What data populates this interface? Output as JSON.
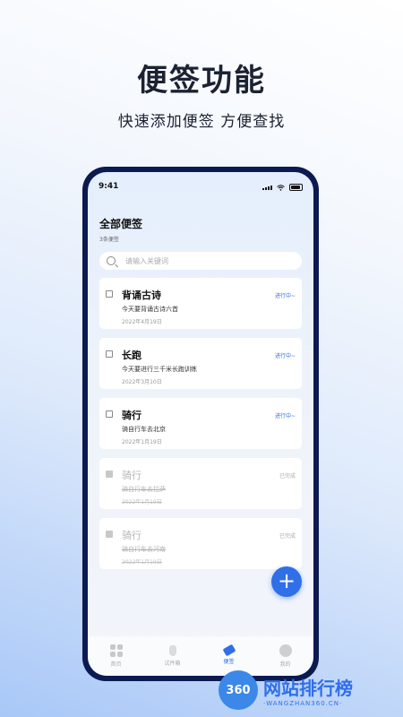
{
  "hero": {
    "title": "便签功能",
    "subtitle": "快速添加便签 方便查找"
  },
  "status_bar": {
    "time": "9:41"
  },
  "page": {
    "title": "全部便签",
    "count": "3条便签"
  },
  "search": {
    "placeholder": "请输入关键词",
    "value": ""
  },
  "notes": [
    {
      "title": "背诵古诗",
      "desc": "今天要背诵古诗六首",
      "date": "2022年4月19日",
      "status": "进行中~",
      "done": false
    },
    {
      "title": "长跑",
      "desc": "今天要进行三千米长跑训练",
      "date": "2022年3月10日",
      "status": "进行中~",
      "done": false
    },
    {
      "title": "骑行",
      "desc": "骑自行车去北京",
      "date": "2022年1月19日",
      "status": "进行中~",
      "done": false
    },
    {
      "title": "骑行",
      "desc": "骑自行车去拉萨",
      "date": "2022年1月19日",
      "status": "已完成",
      "done": true
    },
    {
      "title": "骑行",
      "desc": "骑自行车去河南",
      "date": "2022年1月19日",
      "status": "已完成",
      "done": true
    }
  ],
  "fab": {
    "label": "+"
  },
  "tabs": [
    {
      "label": "首页",
      "icon": "grid-icon"
    },
    {
      "label": "试件箱",
      "icon": "bottle-icon"
    },
    {
      "label": "便签",
      "icon": "tag-icon",
      "active": true
    },
    {
      "label": "我的",
      "icon": "face-icon"
    }
  ],
  "watermark": {
    "badge": "360",
    "name": "网站排行榜",
    "url": "·WANGZHAN360.CN·"
  },
  "colors": {
    "accent": "#2f6fe8",
    "phone_frame": "#0c1a52"
  }
}
